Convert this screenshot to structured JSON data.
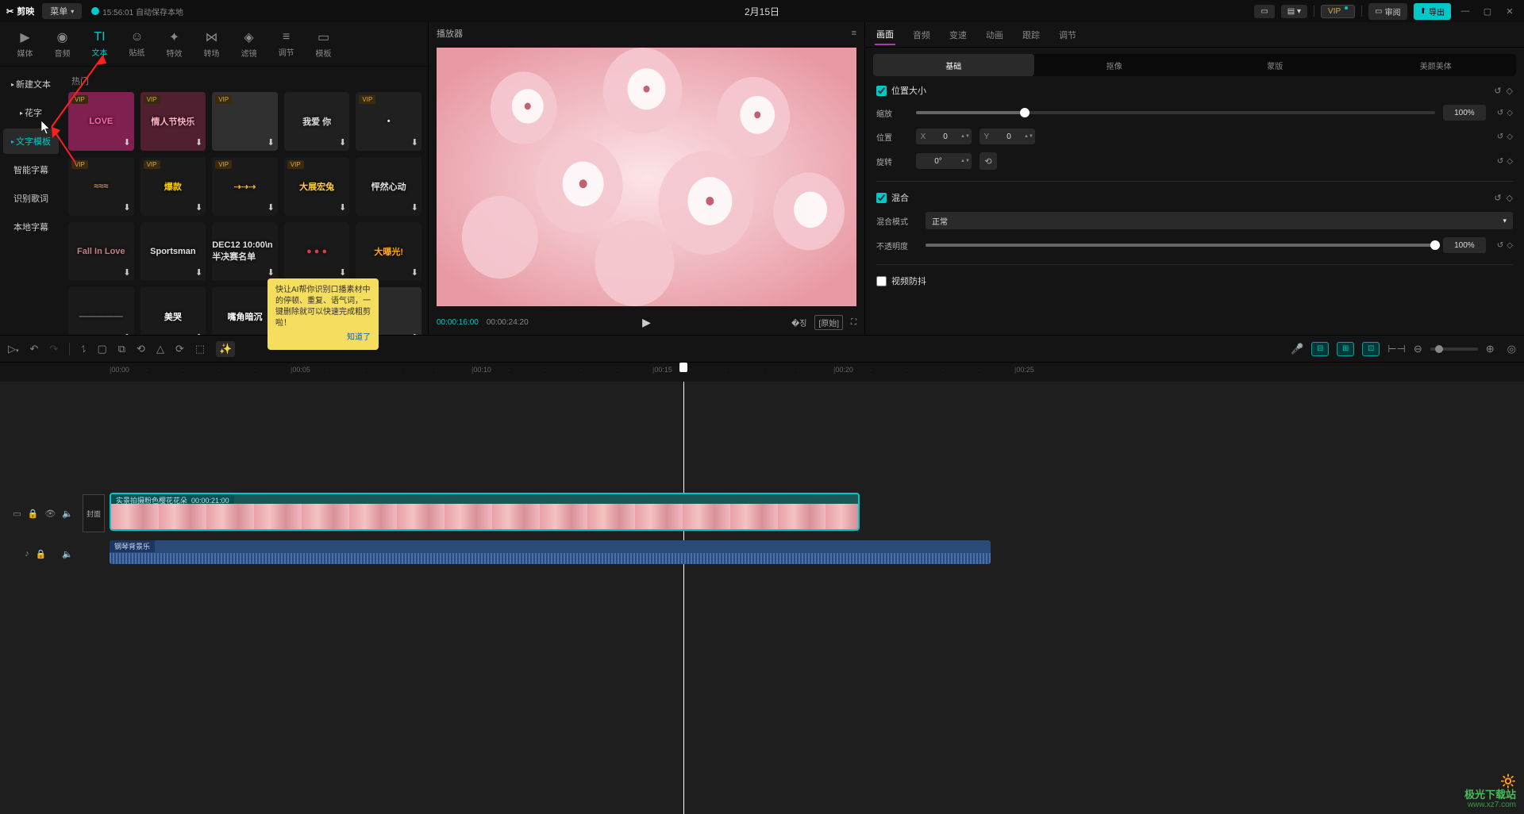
{
  "titlebar": {
    "app_name": "剪映",
    "menu": "菜单",
    "autosave": "15:56:01 自动保存本地",
    "project_title": "2月15日",
    "review": "审阅",
    "export": "导出",
    "vip": "VIP"
  },
  "tool_tabs": [
    {
      "id": "media",
      "label": "媒体",
      "icon": "▶"
    },
    {
      "id": "audio",
      "label": "音频",
      "icon": "◉"
    },
    {
      "id": "text",
      "label": "文本",
      "icon": "TI",
      "active": true
    },
    {
      "id": "sticker",
      "label": "贴纸",
      "icon": "☺"
    },
    {
      "id": "effect",
      "label": "特效",
      "icon": "✦"
    },
    {
      "id": "transition",
      "label": "转场",
      "icon": "⋈"
    },
    {
      "id": "filter",
      "label": "滤镜",
      "icon": "◈"
    },
    {
      "id": "adjust",
      "label": "调节",
      "icon": "≡"
    },
    {
      "id": "template",
      "label": "模板",
      "icon": "▭"
    }
  ],
  "side_cats": [
    {
      "id": "new",
      "label": "新建文本",
      "arrow": true
    },
    {
      "id": "flower",
      "label": "花字",
      "arrow": true
    },
    {
      "id": "tmpl",
      "label": "文字模板",
      "arrow": true,
      "active": true
    },
    {
      "id": "smart",
      "label": "智能字幕"
    },
    {
      "id": "lyric",
      "label": "识别歌词"
    },
    {
      "id": "local",
      "label": "本地字幕"
    }
  ],
  "asset_section": "热门",
  "assets": [
    {
      "txt": "LOVE",
      "vip": true,
      "bg": "#802050",
      "fg": "#ff66aa"
    },
    {
      "txt": "情人节快乐",
      "vip": true,
      "bg": "#502030",
      "fg": "#ffb0c0"
    },
    {
      "txt": "",
      "vip": true,
      "bg": "#303030"
    },
    {
      "txt": "我爱   你",
      "vip": false,
      "bg": "#202020",
      "fg": "#e0e0e0"
    },
    {
      "txt": "•",
      "vip": true,
      "bg": "#202020"
    },
    {
      "txt": "≈≈≈",
      "vip": true,
      "bg": "#1a1a1a",
      "fg": "#c0a040"
    },
    {
      "txt": "爆款",
      "vip": true,
      "bg": "#1a1a1a",
      "fg": "#ffcc00"
    },
    {
      "txt": "⇢⇢⇢",
      "vip": true,
      "bg": "#1a1a1a",
      "fg": "#ffaa00"
    },
    {
      "txt": "大展宏兔",
      "vip": true,
      "bg": "#1a1a1a",
      "fg": "#ffcc44"
    },
    {
      "txt": "怦然心动",
      "vip": false,
      "bg": "#1a1a1a",
      "fg": "#e0e0e0"
    },
    {
      "txt": "Fall In Love",
      "vip": false,
      "bg": "#1a1a1a",
      "fg": "#c08080"
    },
    {
      "txt": "Sportsman",
      "vip": false,
      "bg": "#1a1a1a",
      "fg": "#e0e0e0"
    },
    {
      "txt": "DEC12 10:00\\n半决赛名单",
      "vip": false,
      "bg": "#1a1a1a",
      "fg": "#e0e0e0"
    },
    {
      "txt": "● ● ●",
      "vip": false,
      "bg": "#1a1a1a",
      "fg": "#d04040"
    },
    {
      "txt": "大曝光!",
      "vip": false,
      "bg": "#1a1a1a",
      "fg": "#ffaa00"
    },
    {
      "txt": "—————",
      "vip": false,
      "bg": "#1a1a1a",
      "fg": "#808080"
    },
    {
      "txt": "美哭",
      "vip": false,
      "bg": "#1a1a1a",
      "fg": "#ffffff"
    },
    {
      "txt": "嘴角暗沉",
      "vip": false,
      "bg": "#1a1a1a",
      "fg": "#ffffff"
    },
    {
      "txt": "",
      "vip": false,
      "bg": "#2a2a2a"
    },
    {
      "txt": "",
      "vip": false,
      "bg": "#2a2a2a"
    }
  ],
  "tooltip": {
    "text": "快让AI帮你识别口播素材中的停顿、重复、语气词，一键删除就可以快速完成粗剪啦！",
    "ok": "知道了"
  },
  "preview": {
    "title": "播放器",
    "time_current": "00:00:16:00",
    "time_duration": "00:00:24:20",
    "ratio_label": "[原始]"
  },
  "props": {
    "tabs": [
      "画面",
      "音频",
      "变速",
      "动画",
      "跟踪",
      "调节"
    ],
    "active_tab": 0,
    "subtabs": [
      "基础",
      "抠像",
      "蒙版",
      "美颜美体"
    ],
    "active_subtab": 0,
    "pos_size_label": "位置大小",
    "scale_label": "缩放",
    "scale_value": "100%",
    "position_label": "位置",
    "pos_x_label": "X",
    "pos_x": "0",
    "pos_y_label": "Y",
    "pos_y": "0",
    "rotate_label": "旋转",
    "rotate_value": "0°",
    "blend_label": "混合",
    "blend_mode_label": "混合模式",
    "blend_mode_value": "正常",
    "opacity_label": "不透明度",
    "opacity_value": "100%",
    "stabilize_label": "视频防抖"
  },
  "timeline": {
    "marks": [
      "00:00",
      "00:05",
      "00:10",
      "00:15",
      "00:20",
      "00:25"
    ],
    "cover_label": "封面",
    "video_clip": {
      "label": "实景拍摄粉色樱花花朵",
      "dur": "00:00:21:00"
    },
    "audio_clip": {
      "label": "钢琴背景乐"
    }
  },
  "watermark": {
    "line1": "极光下载站",
    "line2": "www.xz7.com"
  }
}
